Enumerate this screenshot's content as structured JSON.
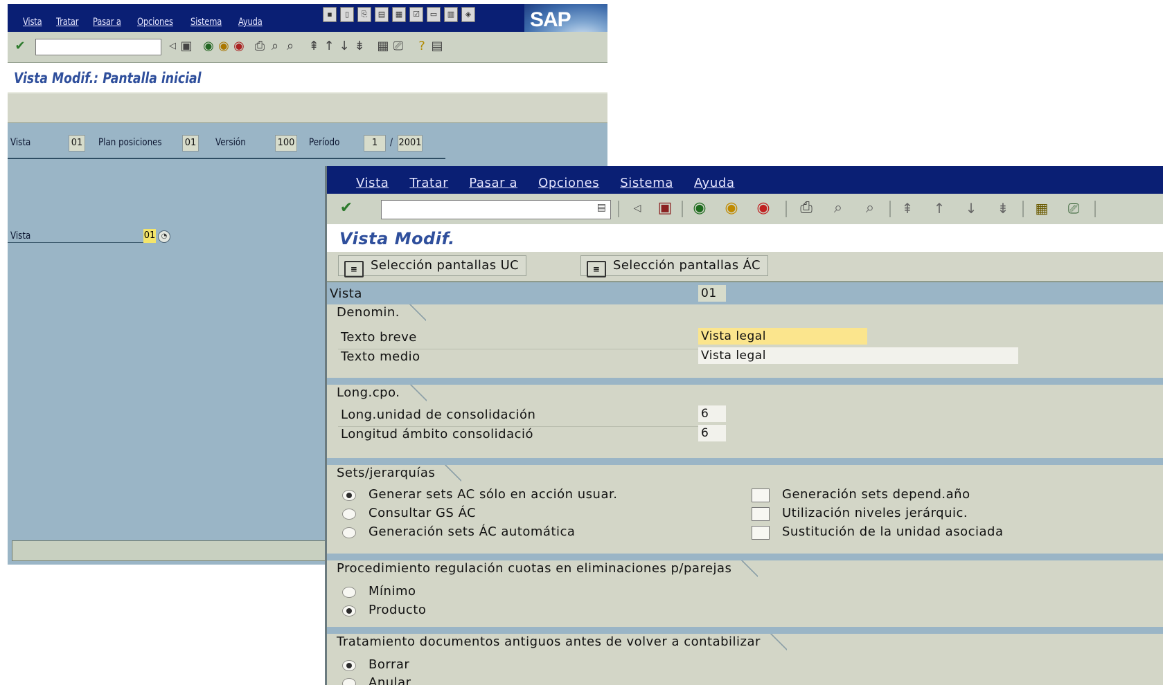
{
  "window1": {
    "menu": [
      "Vista",
      "Tratar",
      "Pasar a",
      "Opciones",
      "Sistema",
      "Ayuda"
    ],
    "logo": "SAP",
    "title": "Vista Modif.: Pantalla inicial",
    "header": {
      "vista_label": "Vista",
      "vista_value": "01",
      "plan_label": "Plan posiciones",
      "plan_value": "01",
      "version_label": "Versión",
      "version_value": "100",
      "periodo_label": "Período",
      "periodo_value": "1",
      "periodo_sep": "/",
      "year_value": "2001"
    },
    "vista_field": {
      "label": "Vista",
      "value": "01"
    }
  },
  "window2": {
    "menu": [
      "Vista",
      "Tratar",
      "Pasar a",
      "Opciones",
      "Sistema",
      "Ayuda"
    ],
    "title": "Vista Modif.",
    "buttons": [
      "Selección pantallas UC",
      "Selección pantallas ÁC"
    ],
    "vista": {
      "label": "Vista",
      "value": "01"
    },
    "denomin": {
      "title": "Denomin.",
      "texto_breve_label": "Texto breve",
      "texto_breve_value": "Vista legal",
      "texto_medio_label": "Texto medio",
      "texto_medio_value": "Vista legal"
    },
    "longcpo": {
      "title": "Long.cpo.",
      "unidad_label": "Long.unidad de consolidación",
      "unidad_value": "6",
      "ambito_label": "Longitud ámbito consolidació",
      "ambito_value": "6"
    },
    "sets": {
      "title": "Sets/jerarquías",
      "radios": [
        {
          "label": "Generar sets AC sólo en acción usuar.",
          "selected": true
        },
        {
          "label": "Consultar GS ÁC",
          "selected": false
        },
        {
          "label": "Generación sets ÁC automática",
          "selected": false
        }
      ],
      "checks": [
        {
          "label": "Generación sets depend.año",
          "checked": false
        },
        {
          "label": "Utilización niveles jerárquic.",
          "checked": false
        },
        {
          "label": "Sustitución de la unidad asociada",
          "checked": false
        }
      ]
    },
    "procedimiento": {
      "title": "Procedimiento regulación cuotas en eliminaciones p/parejas",
      "radios": [
        {
          "label": "Mínimo",
          "selected": false
        },
        {
          "label": "Producto",
          "selected": true
        }
      ]
    },
    "tratamiento": {
      "title": "Tratamiento documentos antiguos antes de volver a contabilizar",
      "radios": [
        {
          "label": "Borrar",
          "selected": true
        },
        {
          "label": "Anular",
          "selected": false
        }
      ]
    }
  }
}
